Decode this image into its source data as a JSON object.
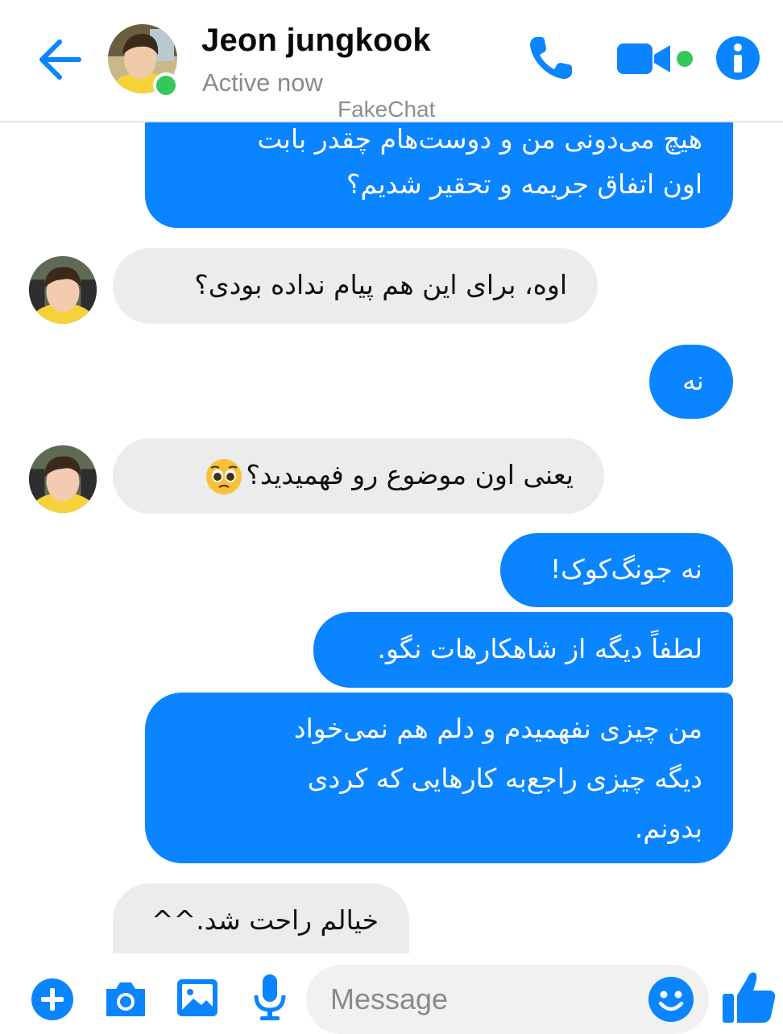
{
  "header": {
    "contact_name": "Jeon jungkook",
    "status": "Active now",
    "watermark": "FakeChat",
    "accent_color": "#0a84ff",
    "online_color": "#34c759",
    "icons": [
      "back-arrow-icon",
      "phone-icon",
      "video-camera-icon",
      "info-icon"
    ]
  },
  "messages": [
    {
      "from": "me",
      "text_lines": [
        "هیچ می‌دونی من و دوست‌هام چقدر بابت",
        "اون اتفاق جریمه و تحقیر شدیم؟"
      ]
    },
    {
      "from": "contact",
      "text": "اوه، برای این هم پیام نداده بودی؟"
    },
    {
      "from": "me",
      "text": "نه"
    },
    {
      "from": "contact",
      "text": "یعنی اون موضوع رو فهمیدید؟",
      "emoji": "pleading-face"
    },
    {
      "from": "me",
      "text": "نه جونگ‌کوک!"
    },
    {
      "from": "me",
      "text": "لطفاً دیگه از شاهکارهات نگو."
    },
    {
      "from": "me",
      "text_lines": [
        "من چیزی نفهمیدم و دلم هم نمی‌خواد",
        "دیگه چیزی راجع‌به کارهایی که کردی",
        "بدونم."
      ]
    },
    {
      "from": "contact",
      "text": "خیالم راحت شد.^^"
    }
  ],
  "composer": {
    "placeholder": "Message",
    "icons": [
      "plus-icon",
      "camera-icon",
      "image-icon",
      "microphone-icon",
      "emoji-icon",
      "thumbs-up-icon"
    ]
  }
}
